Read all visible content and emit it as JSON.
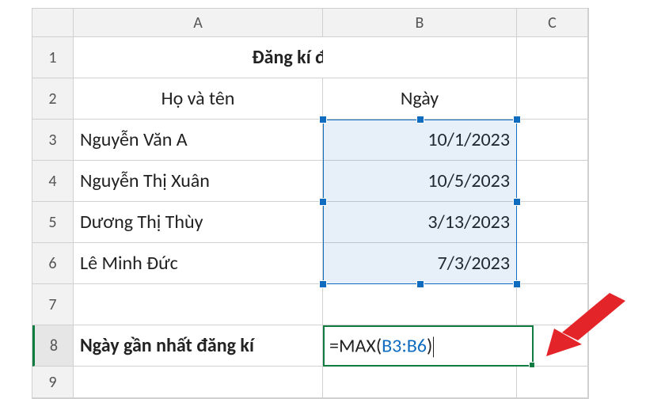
{
  "columns": {
    "A": "A",
    "B": "B",
    "C": "C"
  },
  "row_labels": {
    "r1": "1",
    "r2": "2",
    "r3": "3",
    "r4": "4",
    "r5": "5",
    "r6": "6",
    "r7": "7",
    "r8": "8",
    "r9": "9"
  },
  "title": "Đăng kí đi thực tập",
  "headers": {
    "name": "Họ và tên",
    "date": "Ngày"
  },
  "rows": [
    {
      "name": "Nguyễn Văn A",
      "date": "10/1/2023"
    },
    {
      "name": "Nguyễn Thị Xuân",
      "date": "10/5/2023"
    },
    {
      "name": "Dương Thị Thùy",
      "date": "3/13/2023"
    },
    {
      "name": "Lê Minh Đức",
      "date": "7/3/2023"
    }
  ],
  "result_label": "Ngày gần nhất đăng kí",
  "formula": {
    "prefix": "=MAX(",
    "ref": "B3:B6",
    "suffix": ")"
  },
  "selection": {
    "range": "B3:B6"
  },
  "active_cell": "B8",
  "chart_data": {
    "type": "table",
    "title": "Đăng kí đi thực tập",
    "columns": [
      "Họ và tên",
      "Ngày"
    ],
    "rows": [
      [
        "Nguyễn Văn A",
        "10/1/2023"
      ],
      [
        "Nguyễn Thị Xuân",
        "10/5/2023"
      ],
      [
        "Dương Thị Thùy",
        "3/13/2023"
      ],
      [
        "Lê Minh Đức",
        "7/3/2023"
      ]
    ],
    "formula_row": [
      "Ngày gần nhất đăng kí",
      "=MAX(B3:B6)"
    ]
  }
}
